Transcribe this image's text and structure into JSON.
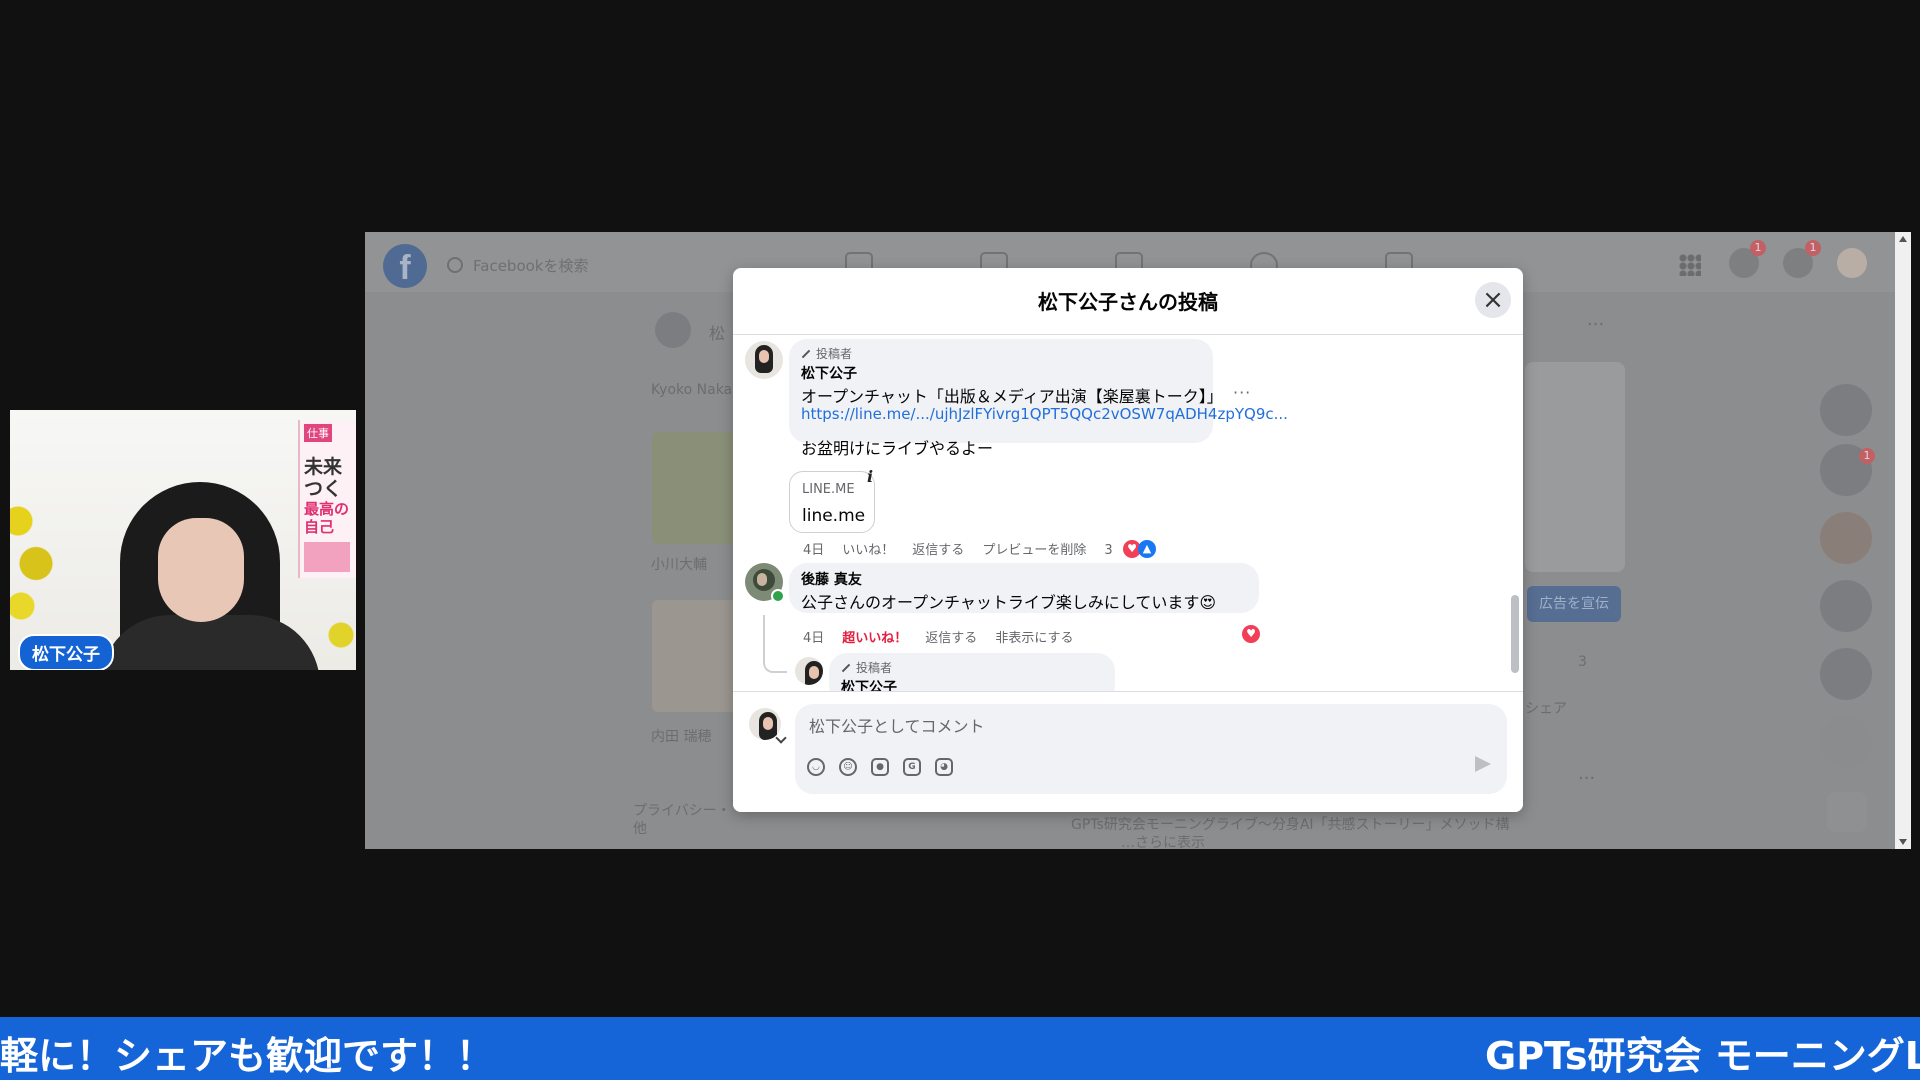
{
  "webcam": {
    "name_label": "松下公子",
    "book": {
      "tag": "仕事",
      "title_a": "未来",
      "title_b": "つく",
      "title_c": "最高の",
      "title_d": "自己"
    }
  },
  "facebook": {
    "search_placeholder": "Facebookを検索",
    "notifications": {
      "messenger_badge": "1",
      "bell_badge": "1",
      "contact_badge": "1"
    },
    "background": {
      "profile_name": "Kyoko Naka",
      "person1": "小川大輔",
      "person2": "内田 瑞穂",
      "privacy": "プライバシー・",
      "privacy2": "他",
      "side_button": "広告を宣伝",
      "count": "3",
      "share": "シェア",
      "feed_line1": "GPTs研究会モーニングライブ〜分身AI「共感ストーリー」メソッド構",
      "feed_line2": "…さらに表示",
      "top_initial": "松"
    }
  },
  "modal": {
    "title": "松下公子さんの投稿",
    "comments": [
      {
        "author_tag": "投稿者",
        "name": "松下公子",
        "line1": "オープンチャット「出版＆メディア出演【楽屋裏トーク】」",
        "link": "https://line.me/.../ujhJzlFYivrg1QPT5QQc2vOSW7qADH4zpYQ9c...",
        "line2": "お盆明けにライブやるよー",
        "card_domain": "LINE.ME",
        "card_title": "line.me",
        "time": "4日",
        "like": "いいね！",
        "reply": "返信する",
        "remove_preview": "プレビューを削除",
        "reaction_count": "3"
      },
      {
        "name": "後藤 真友",
        "text": "公子さんのオープンチャットライブ楽しみにしています😍",
        "time": "4日",
        "super_like": "超いいね！",
        "reply": "返信する",
        "hide": "非表示にする"
      },
      {
        "author_tag": "投稿者",
        "name": "松下公子"
      }
    ],
    "composer_placeholder": "松下公子としてコメント",
    "tools": [
      "avatar-sticker-icon",
      "emoji-icon",
      "camera-icon",
      "gif-icon",
      "sticker-icon"
    ]
  },
  "ticker": {
    "left": "軽に！シェアも歓迎です！！",
    "right": "GPTs研究会 モーニングL"
  }
}
